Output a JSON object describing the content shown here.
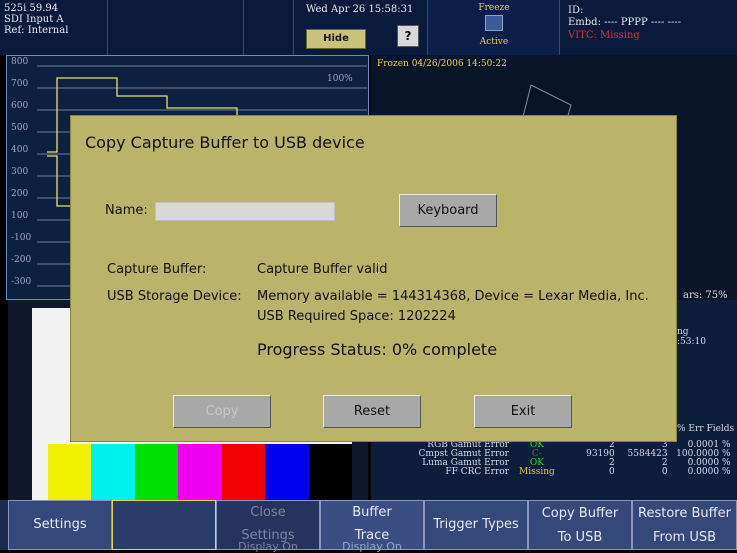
{
  "topbar": {
    "format": "525i 59.94",
    "input": "SDI Input A",
    "ref": "Ref: Internal",
    "datetime": "Wed Apr 26 15:58:31",
    "hide_menu": "Hide Menu",
    "help": "?",
    "freeze_label": "Freeze",
    "freeze_state": "Active",
    "id": "ID:",
    "embd": "Embd: ---- PPPP ---- ----",
    "vitc": "VITC: Missing"
  },
  "waveform": {
    "ticks": [
      "800",
      "700",
      "600",
      "500",
      "400",
      "300",
      "200",
      "100",
      "-100",
      "-200",
      "-300"
    ],
    "pct100": "100%"
  },
  "vector": {
    "frozen": "Frozen 04/26/2006 14:50:22",
    "ars": "ars: 75%"
  },
  "status": {
    "side1": "ng",
    "side2": ":53:10",
    "header": "% Err Fields",
    "rows": [
      {
        "label": "RGB Gamut Error",
        "state": "OK",
        "c1": "2",
        "c2": "3",
        "pct": "0.0001 %",
        "color": "#3ad03a"
      },
      {
        "label": "Cmpst Gamut Error",
        "state": "C-",
        "c1": "93190",
        "c2": "5584423",
        "pct": "100.0000 %",
        "color": "#e03030"
      },
      {
        "label": "Luma Gamut Error",
        "state": "OK",
        "c1": "2",
        "c2": "2",
        "pct": "0.0000 %",
        "color": "#3ad03a"
      },
      {
        "label": "FF CRC Error",
        "state": "Missing",
        "c1": "0",
        "c2": "0",
        "pct": "0.0000 %",
        "color": "#e0d030"
      }
    ]
  },
  "dialog": {
    "title": "Copy Capture Buffer to USB device",
    "name_label": "Name:",
    "name_value": "",
    "keyboard": "Keyboard",
    "capture_label": "Capture Buffer:",
    "capture_value": "Capture Buffer valid",
    "usb_label": "USB Storage Device:",
    "usb_value": "Memory available = 144314368, Device = Lexar Media, Inc.",
    "usb_required": "USB Required Space: 1202224",
    "progress": "Progress Status: 0% complete",
    "copy": "Copy",
    "reset": "Reset",
    "exit": "Exit"
  },
  "bottom": {
    "settings": "Settings",
    "close": "Close",
    "settings2": "Settings",
    "display_on1": "Display On",
    "buffer": "Buffer",
    "trace": "Trace",
    "display_on2": "Display On",
    "trigger": "Trigger Types",
    "copy_buffer_1": "Copy Buffer",
    "copy_buffer_2": "To USB",
    "restore_1": "Restore Buffer",
    "restore_2": "From USB"
  },
  "colors": {
    "dialog_bg": "#bab36a",
    "accent_yellow": "#c8c27a",
    "missing_red": "#e03030"
  }
}
